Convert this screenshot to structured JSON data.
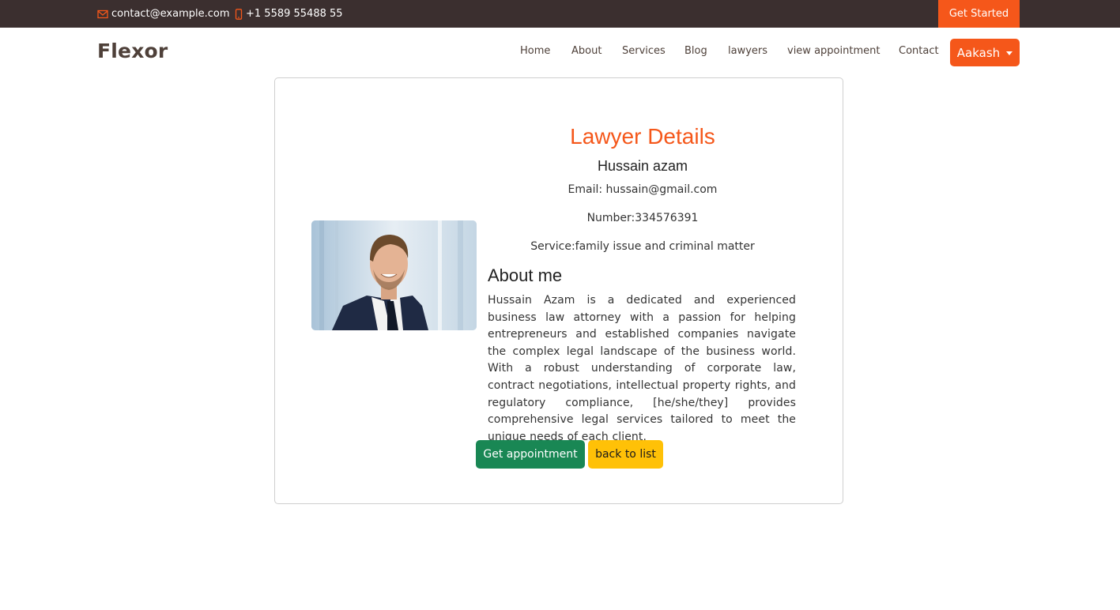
{
  "topbar": {
    "email": "contact@example.com",
    "email_icon": "envelope-icon",
    "phone": "+1 5589 55488 55",
    "phone_icon": "phone-icon",
    "cta_label": "Get Started"
  },
  "header": {
    "logo": "Flexor",
    "nav": [
      "Home",
      "About",
      "Services",
      "Blog",
      "lawyers",
      "view appointment",
      "Contact"
    ],
    "user_label": "Aakash",
    "user_icon": "caret-down-icon"
  },
  "colors": {
    "accent": "#f5571a",
    "topbar_bg": "#3b2f2f",
    "success": "#198754",
    "warning": "#ffc107"
  },
  "lawyer": {
    "title": "Lawyer Details",
    "name": "Hussain azam",
    "email_line": "Email: hussain@gmail.com",
    "number_line": "Number:334576391",
    "service_line": "Service:family issue and criminal matter",
    "about_title": "About me",
    "about_text": "Hussain Azam is a dedicated and experienced business law attorney with a passion for helping entrepreneurs and established companies navigate the complex legal landscape of the business world. With a robust understanding of corporate law, contract negotiations, intellectual property rights, and regulatory compliance, [he/she/they] provides comprehensive legal services tailored to meet the unique needs of each client.",
    "photo": "lawyer-photo"
  },
  "actions": {
    "appointment_label": "Get appointment",
    "back_label": "back to list"
  }
}
